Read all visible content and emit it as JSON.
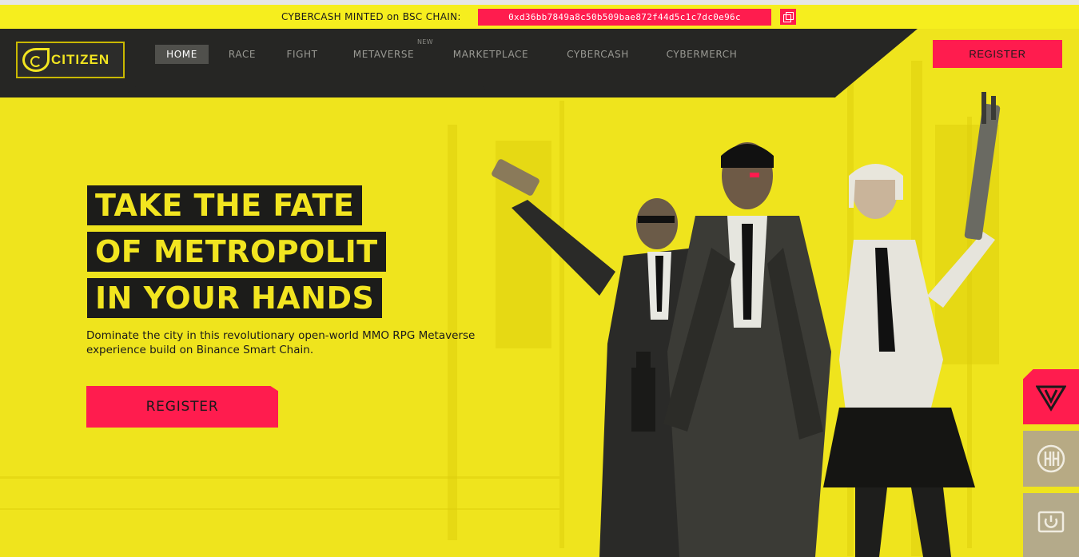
{
  "topbar": {
    "label": "CYBERCASH MINTED on BSC CHAIN:",
    "contract_address": "0xd36bb7849a8c50b509bae872f44d5c1c7dc0e96c"
  },
  "logo": {
    "text": "CITIZEN"
  },
  "nav": {
    "items": [
      {
        "label": "HOME",
        "active": true
      },
      {
        "label": "RACE"
      },
      {
        "label": "FIGHT"
      },
      {
        "label": "METAVERSE"
      },
      {
        "label": "MARKETPLACE"
      },
      {
        "label": "CYBERCASH"
      },
      {
        "label": "CYBERMERCH"
      }
    ],
    "new_badge": "NEW",
    "register_label": "REGISTER"
  },
  "hero": {
    "headline_lines": [
      "TAKE THE FATE",
      "OF METROPOLIT",
      "IN YOUR HANDS"
    ],
    "subtitle": "Dominate the city in this revolutionary open-world MMO RPG Metaverse experience build on Binance Smart Chain.",
    "register_label": "REGISTER"
  },
  "side_icons": [
    "triangle-logo-icon",
    "hh-badge-icon",
    "power-icon"
  ],
  "colors": {
    "accent_yellow": "#f2e520",
    "accent_red": "#ff1c4e",
    "dark": "#262624"
  }
}
